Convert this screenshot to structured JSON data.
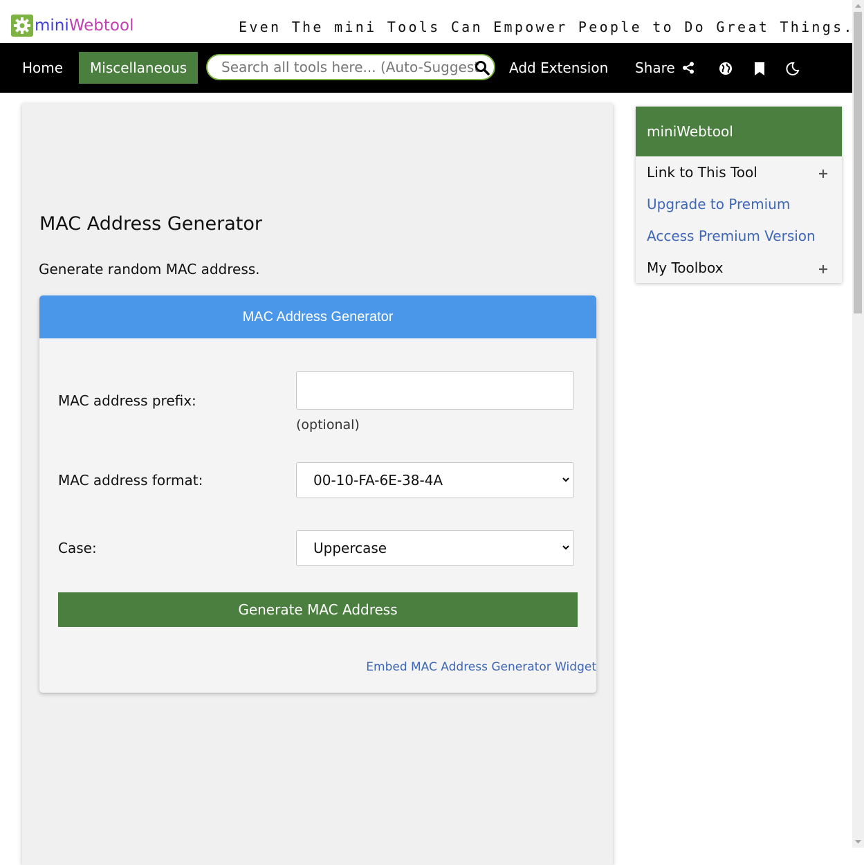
{
  "brand": {
    "name_part1": "mini",
    "name_part2": "Webtool",
    "tagline": "Even The mini Tools Can Empower People to Do Great Things.",
    "colors": {
      "logo_green": "#7cb342",
      "mini": "#3f3fd4",
      "webtool": "#c23fb0"
    }
  },
  "nav": {
    "home": "Home",
    "category": "Miscellaneous",
    "search_placeholder": "Search all tools here... (Auto-Suggest)",
    "add_extension": "Add Extension",
    "share": "Share",
    "icons": [
      "share-icon",
      "globe-icon",
      "bookmark-icon",
      "moon-icon"
    ]
  },
  "page": {
    "title": "MAC Address Generator",
    "description": "Generate random MAC address."
  },
  "tool": {
    "header": "MAC Address Generator",
    "prefix_label": "MAC address prefix:",
    "prefix_value": "",
    "prefix_hint": "(optional)",
    "format_label": "MAC address format:",
    "format_value": "00-10-FA-6E-38-4A",
    "case_label": "Case:",
    "case_value": "Uppercase",
    "generate_button": "Generate MAC Address",
    "embed_link": "Embed MAC Address Generator Widget",
    "colors": {
      "header": "#4a96e8",
      "button": "#4b7f3f"
    }
  },
  "sidebar": {
    "title": "miniWebtool",
    "items": [
      {
        "label": "Link to This Tool"
      },
      {
        "label": "Upgrade to Premium"
      },
      {
        "label": "Access Premium Version"
      },
      {
        "label": "My Toolbox"
      }
    ]
  }
}
